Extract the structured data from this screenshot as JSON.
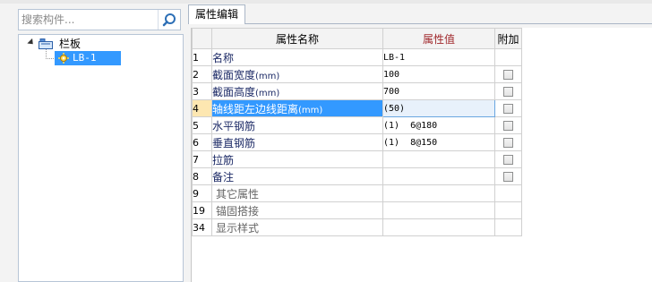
{
  "search": {
    "placeholder": "搜索构件..."
  },
  "tree": {
    "root_label": "栏板",
    "child_label": "LB-1"
  },
  "tab": {
    "label": "属性编辑"
  },
  "grid": {
    "headers": {
      "name": "属性名称",
      "value": "属性值",
      "extra": "附加"
    },
    "rows": [
      {
        "idx": "1",
        "name": "名称",
        "unit": "",
        "value": "LB-1",
        "checkbox": false
      },
      {
        "idx": "2",
        "name": "截面宽度",
        "unit": "(mm)",
        "value": "100",
        "checkbox": true
      },
      {
        "idx": "3",
        "name": "截面高度",
        "unit": "(mm)",
        "value": "700",
        "checkbox": true
      },
      {
        "idx": "4",
        "name": "轴线距左边线距离",
        "unit": "(mm)",
        "value": "(50)",
        "checkbox": true
      },
      {
        "idx": "5",
        "name": "水平钢筋",
        "unit": "",
        "value": "(1)  6@180",
        "checkbox": true
      },
      {
        "idx": "6",
        "name": "垂直钢筋",
        "unit": "",
        "value": "(1)  8@150",
        "checkbox": true
      },
      {
        "idx": "7",
        "name": "拉筋",
        "unit": "",
        "value": "",
        "checkbox": true
      },
      {
        "idx": "8",
        "name": "备注",
        "unit": "",
        "value": "",
        "checkbox": true
      },
      {
        "idx": "9",
        "name": "其它属性",
        "unit": "",
        "value": "",
        "checkbox": false
      },
      {
        "idx": "19",
        "name": "锚固搭接",
        "unit": "",
        "value": "",
        "checkbox": false
      },
      {
        "idx": "34",
        "name": "显示样式",
        "unit": "",
        "value": "",
        "checkbox": false
      }
    ]
  },
  "colors": {
    "selection": "#3399ff",
    "value_header": "#f6b24a",
    "value_header_text": "#a0282c"
  }
}
